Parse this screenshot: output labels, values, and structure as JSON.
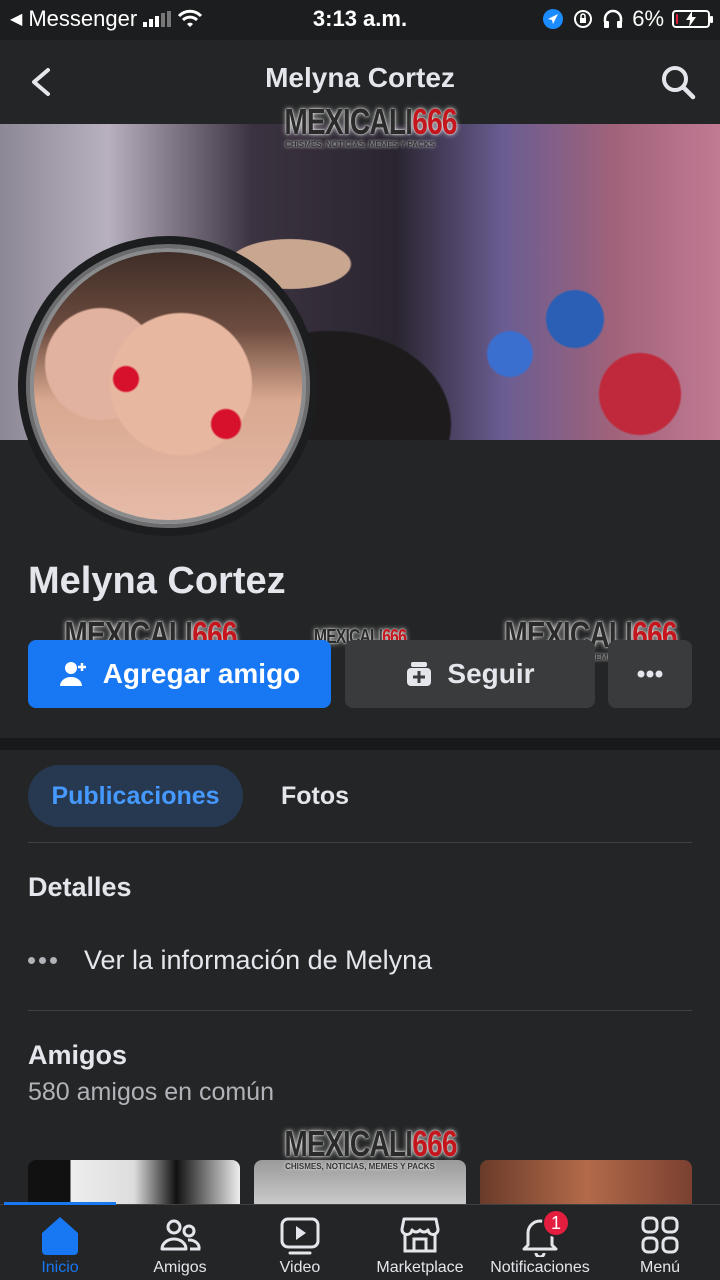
{
  "status_bar": {
    "back_app": "Messenger",
    "time": "3:13 a.m.",
    "battery": "6%",
    "battery_level": 0.06
  },
  "header": {
    "title": "Melyna Cortez"
  },
  "watermark": {
    "brand_part1": "MEXICALI",
    "brand_part2": "666",
    "tagline": "CHISMES, NOTICIAS, MEMES Y PACKS"
  },
  "profile": {
    "name": "Melyna Cortez"
  },
  "actions": {
    "add_friend": "Agregar amigo",
    "follow": "Seguir"
  },
  "tabs": {
    "posts": "Publicaciones",
    "photos": "Fotos"
  },
  "details": {
    "title": "Detalles",
    "info_link": "Ver la información de Melyna"
  },
  "friends": {
    "title": "Amigos",
    "mutual": "580 amigos en común"
  },
  "bottom_nav": {
    "items": [
      {
        "label": "Inicio",
        "icon": "home-icon"
      },
      {
        "label": "Amigos",
        "icon": "friends-icon"
      },
      {
        "label": "Video",
        "icon": "video-icon"
      },
      {
        "label": "Marketplace",
        "icon": "marketplace-icon"
      },
      {
        "label": "Notificaciones",
        "icon": "bell-icon",
        "badge": "1"
      },
      {
        "label": "Menú",
        "icon": "menu-grid-icon"
      }
    ]
  },
  "colors": {
    "accent": "#1877f2",
    "background": "#242526",
    "badge": "#e41e3f"
  }
}
